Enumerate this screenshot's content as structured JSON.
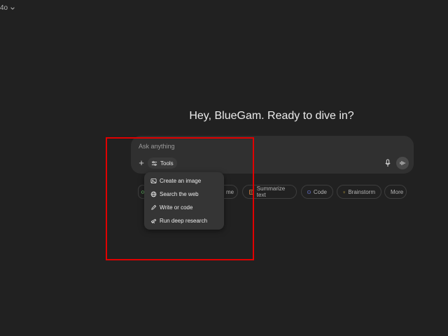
{
  "header": {
    "model_label": "4o"
  },
  "hero": {
    "greeting": "Hey, BlueGam. Ready to dive in?"
  },
  "composer": {
    "placeholder": "Ask anything",
    "tools_label": "Tools"
  },
  "tools_menu": {
    "items": [
      {
        "label": "Create an image",
        "icon": "image-icon"
      },
      {
        "label": "Search the web",
        "icon": "globe-icon"
      },
      {
        "label": "Write or code",
        "icon": "pen-icon"
      },
      {
        "label": "Run deep research",
        "icon": "telescope-icon"
      }
    ]
  },
  "suggestions": {
    "items": [
      {
        "label": "",
        "icon": "green-icon",
        "color": "#6cc56c"
      },
      {
        "label": "me",
        "icon": "none"
      },
      {
        "label": "Summarize text",
        "icon": "document-icon",
        "color": "#e08a4a"
      },
      {
        "label": "Code",
        "icon": "code-icon",
        "color": "#7b8cff"
      },
      {
        "label": "Brainstorm",
        "icon": "lightbulb-icon",
        "color": "#e8c440"
      },
      {
        "label": "More",
        "icon": "none"
      }
    ]
  },
  "colors": {
    "background": "#212121",
    "composer": "#303030",
    "menu": "#353535",
    "annotation_box": "#e00000"
  }
}
